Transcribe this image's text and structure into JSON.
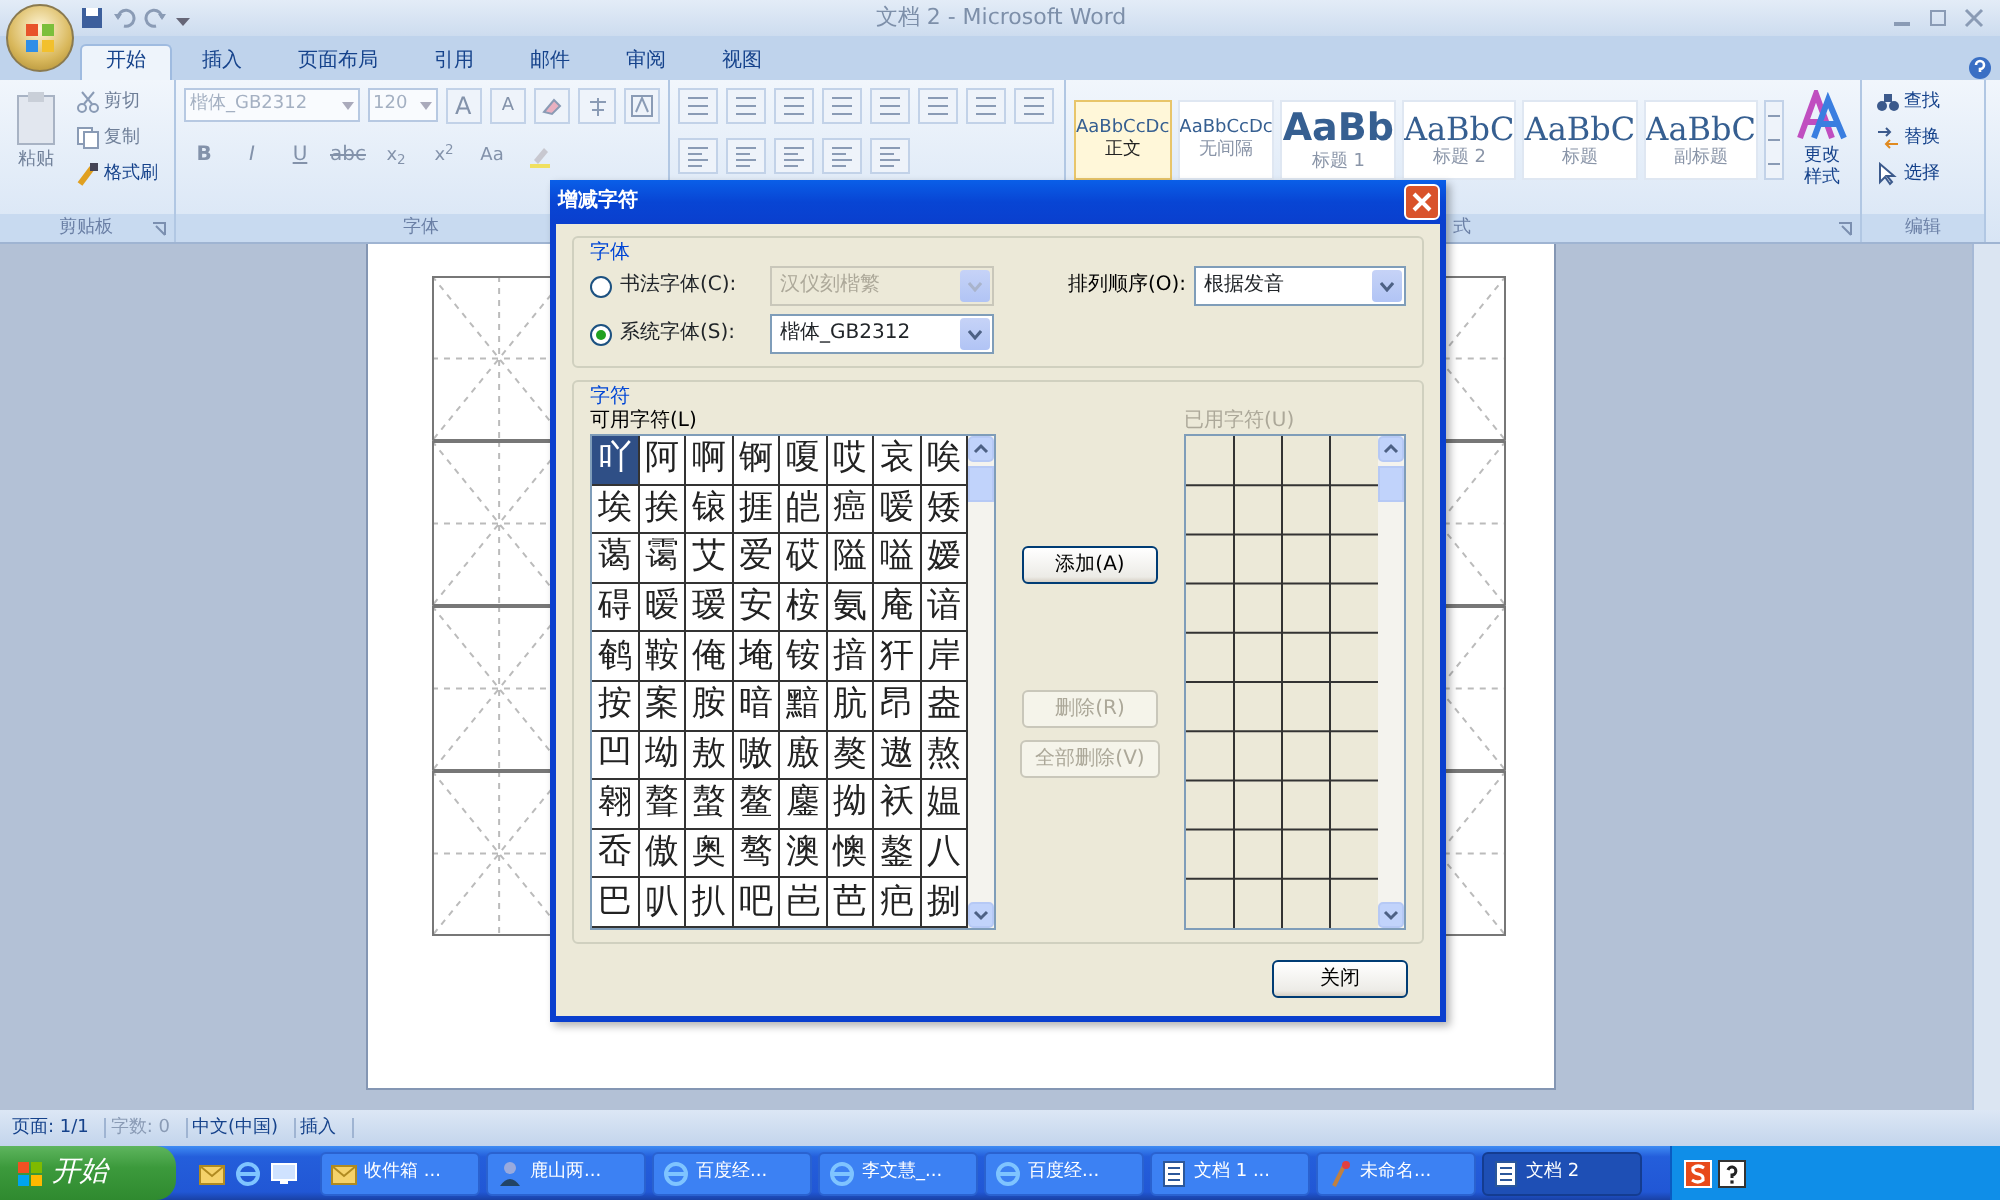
{
  "window": {
    "title": "文档 2 - Microsoft Word"
  },
  "tabs": [
    {
      "label": "开始",
      "selected": true
    },
    {
      "label": "插入",
      "selected": false
    },
    {
      "label": "页面布局",
      "selected": false
    },
    {
      "label": "引用",
      "selected": false
    },
    {
      "label": "邮件",
      "selected": false
    },
    {
      "label": "审阅",
      "selected": false
    },
    {
      "label": "视图",
      "selected": false
    }
  ],
  "ribbon": {
    "clipboard": {
      "label": "剪贴板",
      "paste": "粘贴",
      "items": [
        "剪切",
        "复制",
        "格式刷"
      ]
    },
    "font": {
      "label": "字体",
      "font_name": "楷体_GB2312",
      "font_size": "120",
      "grow": "A",
      "shrink": "A",
      "format_buttons": [
        {
          "kind": "bold",
          "text": "B"
        },
        {
          "kind": "italic",
          "text": "I"
        },
        {
          "kind": "underline",
          "text": "U"
        },
        {
          "kind": "strike",
          "text": "abc"
        },
        {
          "kind": "script",
          "text": "x$_{2}$"
        },
        {
          "kind": "script",
          "text": "x$^{2}$"
        },
        {
          "kind": "case",
          "text": "Aa"
        }
      ]
    },
    "styles": {
      "label": "式",
      "items": [
        {
          "kind": "normal",
          "sample": "AaBbCcDc",
          "name": "正文",
          "selected": true
        },
        {
          "kind": "normal",
          "sample": "AaBbCcDc",
          "name": "无间隔",
          "selected": false
        },
        {
          "kind": "title",
          "sample": "AaBb",
          "name": "标题 1",
          "selected": false
        },
        {
          "kind": "heading",
          "sample": "AaBbC",
          "name": "标题 2",
          "selected": false
        },
        {
          "kind": "heading",
          "sample": "AaBbC",
          "name": "标题",
          "selected": false
        },
        {
          "kind": "heading",
          "sample": "AaBbC",
          "name": "副标题",
          "selected": false
        }
      ],
      "change_styles": "更改样式"
    },
    "editing": {
      "label": "编辑",
      "items": [
        "查找",
        "替换",
        "选择"
      ]
    }
  },
  "dialog": {
    "title": "增减字符",
    "font_group": {
      "label": "字体",
      "options": [
        {
          "label": "书法字体(C):",
          "selected": false,
          "value": "汉仪刻楷繁",
          "disabled": true
        },
        {
          "label": "系统字体(S):",
          "selected": true,
          "value": "楷体_GB2312",
          "disabled": false
        }
      ],
      "sort_label": "排列顺序(O):",
      "sort_value": "根据发音"
    },
    "chars_group": {
      "label": "字符",
      "available_label": "可用字符(L)",
      "used_label": "已用字符(U)",
      "used_disabled": true,
      "available": [
        [
          {
            "text": "吖",
            "selected": true
          },
          {
            "text": "阿",
            "selected": false
          },
          {
            "text": "啊",
            "selected": false
          },
          {
            "text": "锕",
            "selected": false
          },
          {
            "text": "嗄",
            "selected": false
          },
          {
            "text": "哎",
            "selected": false
          },
          {
            "text": "哀",
            "selected": false
          },
          {
            "text": "唉",
            "selected": false
          }
        ],
        [
          {
            "text": "埃",
            "selected": false
          },
          {
            "text": "挨",
            "selected": false
          },
          {
            "text": "锿",
            "selected": false
          },
          {
            "text": "捱",
            "selected": false
          },
          {
            "text": "皑",
            "selected": false
          },
          {
            "text": "癌",
            "selected": false
          },
          {
            "text": "嗳",
            "selected": false
          },
          {
            "text": "矮",
            "selected": false
          }
        ],
        [
          {
            "text": "蔼",
            "selected": false
          },
          {
            "text": "霭",
            "selected": false
          },
          {
            "text": "艾",
            "selected": false
          },
          {
            "text": "爱",
            "selected": false
          },
          {
            "text": "砹",
            "selected": false
          },
          {
            "text": "隘",
            "selected": false
          },
          {
            "text": "嗌",
            "selected": false
          },
          {
            "text": "嫒",
            "selected": false
          }
        ],
        [
          {
            "text": "碍",
            "selected": false
          },
          {
            "text": "暧",
            "selected": false
          },
          {
            "text": "瑷",
            "selected": false
          },
          {
            "text": "安",
            "selected": false
          },
          {
            "text": "桉",
            "selected": false
          },
          {
            "text": "氨",
            "selected": false
          },
          {
            "text": "庵",
            "selected": false
          },
          {
            "text": "谙",
            "selected": false
          }
        ],
        [
          {
            "text": "鹌",
            "selected": false
          },
          {
            "text": "鞍",
            "selected": false
          },
          {
            "text": "俺",
            "selected": false
          },
          {
            "text": "埯",
            "selected": false
          },
          {
            "text": "铵",
            "selected": false
          },
          {
            "text": "揞",
            "selected": false
          },
          {
            "text": "犴",
            "selected": false
          },
          {
            "text": "岸",
            "selected": false
          }
        ],
        [
          {
            "text": "按",
            "selected": false
          },
          {
            "text": "案",
            "selected": false
          },
          {
            "text": "胺",
            "selected": false
          },
          {
            "text": "暗",
            "selected": false
          },
          {
            "text": "黯",
            "selected": false
          },
          {
            "text": "肮",
            "selected": false
          },
          {
            "text": "昂",
            "selected": false
          },
          {
            "text": "盎",
            "selected": false
          }
        ],
        [
          {
            "text": "凹",
            "selected": false
          },
          {
            "text": "坳",
            "selected": false
          },
          {
            "text": "敖",
            "selected": false
          },
          {
            "text": "嗷",
            "selected": false
          },
          {
            "text": "廒",
            "selected": false
          },
          {
            "text": "獒",
            "selected": false
          },
          {
            "text": "遨",
            "selected": false
          },
          {
            "text": "熬",
            "selected": false
          }
        ],
        [
          {
            "text": "翱",
            "selected": false
          },
          {
            "text": "聱",
            "selected": false
          },
          {
            "text": "螯",
            "selected": false
          },
          {
            "text": "鳌",
            "selected": false
          },
          {
            "text": "鏖",
            "selected": false
          },
          {
            "text": "拗",
            "selected": false
          },
          {
            "text": "袄",
            "selected": false
          },
          {
            "text": "媪",
            "selected": false
          }
        ],
        [
          {
            "text": "岙",
            "selected": false
          },
          {
            "text": "傲",
            "selected": false
          },
          {
            "text": "奥",
            "selected": false
          },
          {
            "text": "骜",
            "selected": false
          },
          {
            "text": "澳",
            "selected": false
          },
          {
            "text": "懊",
            "selected": false
          },
          {
            "text": "鏊",
            "selected": false
          },
          {
            "text": "八",
            "selected": false
          }
        ],
        [
          {
            "text": "巴",
            "selected": false
          },
          {
            "text": "叭",
            "selected": false
          },
          {
            "text": "扒",
            "selected": false
          },
          {
            "text": "吧",
            "selected": false
          },
          {
            "text": "岜",
            "selected": false
          },
          {
            "text": "芭",
            "selected": false
          },
          {
            "text": "疤",
            "selected": false
          },
          {
            "text": "捌",
            "selected": false
          }
        ]
      ]
    },
    "buttons": [
      {
        "label": "添加(A)",
        "disabled": false
      },
      {
        "label": "删除(R)",
        "disabled": true
      },
      {
        "label": "全部删除(V)",
        "disabled": true
      }
    ],
    "close": "关闭"
  },
  "status_bar": {
    "items": [
      {
        "text": "页面: 1/1",
        "disabled": false
      },
      {
        "text": "字数: 0",
        "disabled": true
      },
      {
        "text": "中文(中国)",
        "disabled": false
      },
      {
        "text": "插入",
        "disabled": false
      }
    ]
  },
  "taskbar": {
    "start": "开始",
    "tasks": [
      {
        "kind": "mail",
        "label": "收件箱 ...",
        "selected": false
      },
      {
        "kind": "app",
        "label": "鹿山两...",
        "selected": false
      },
      {
        "kind": "browser",
        "label": "百度经...",
        "selected": false
      },
      {
        "kind": "browser",
        "label": "李文慧_...",
        "selected": false
      },
      {
        "kind": "browser",
        "label": "百度经...",
        "selected": false
      },
      {
        "kind": "word",
        "label": "文档 1 ...",
        "selected": false
      },
      {
        "kind": "paint",
        "label": "未命名...",
        "selected": false
      },
      {
        "kind": "word",
        "label": "文档 2",
        "selected": true
      }
    ]
  }
}
